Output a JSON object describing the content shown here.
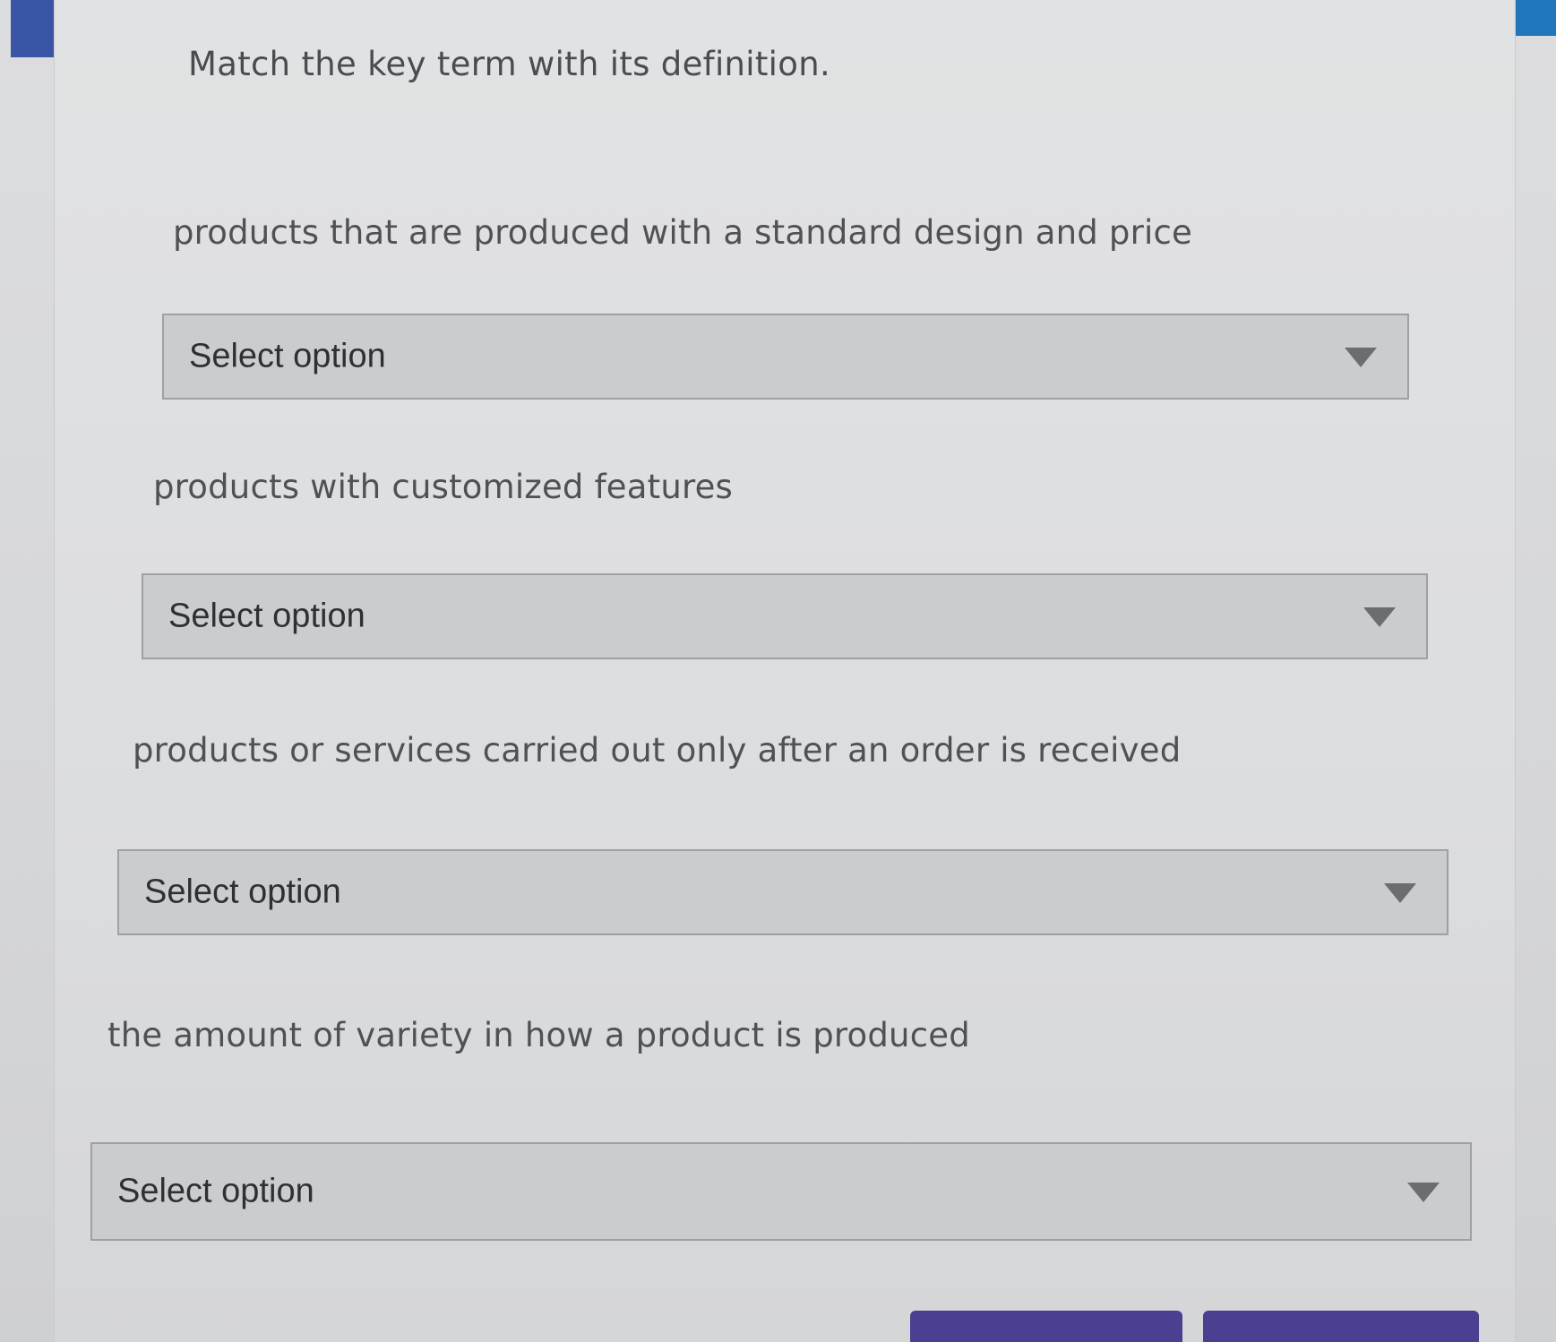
{
  "instruction": "Match the key term with its definition.",
  "items": [
    {
      "definition": "products that are produced with a standard design and price",
      "selected": "Select option"
    },
    {
      "definition": "products with customized features",
      "selected": "Select option"
    },
    {
      "definition": "products or services carried out only after an order is received",
      "selected": "Select option"
    },
    {
      "definition": "the amount of variety in how a product is produced",
      "selected": "Select option"
    }
  ],
  "colors": {
    "accent_left": "#3b55a6",
    "accent_right": "#1f76ba",
    "button": "#4b3f92"
  }
}
